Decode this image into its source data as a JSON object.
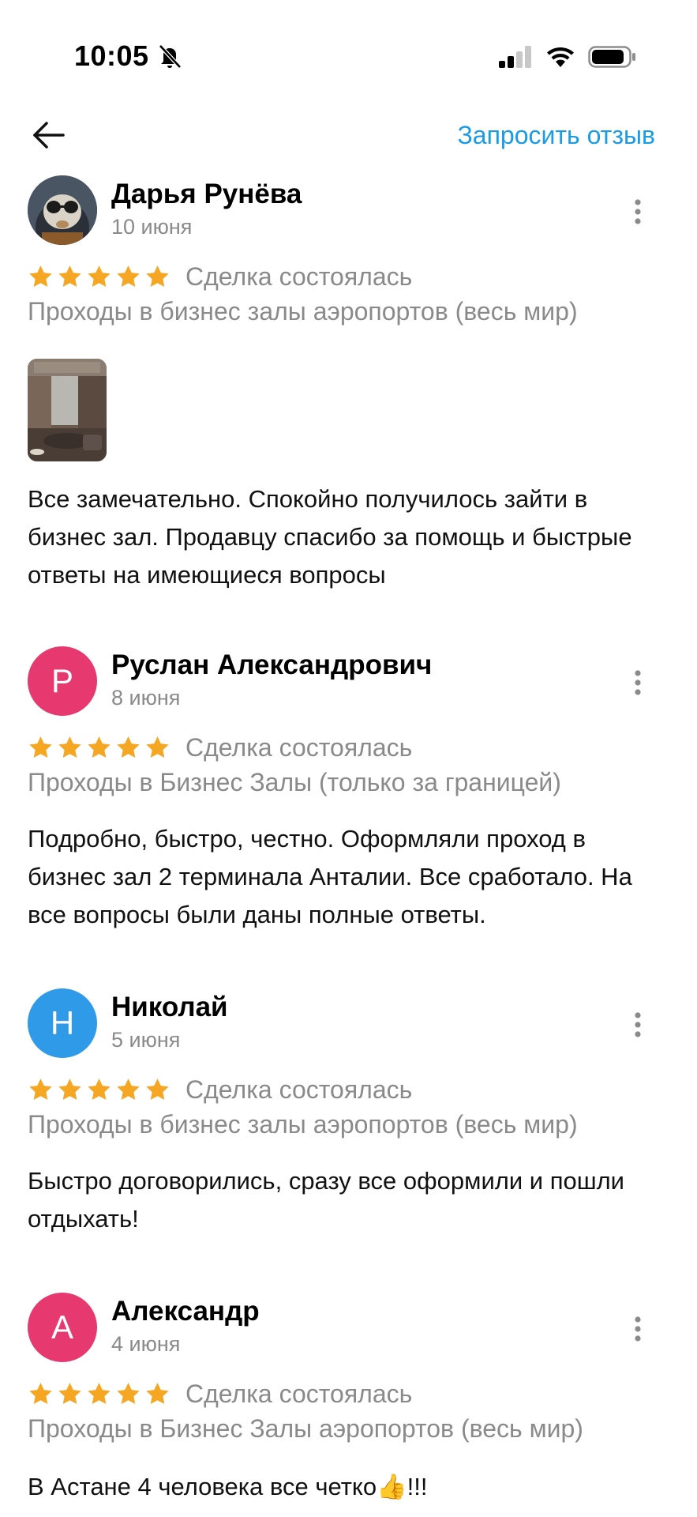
{
  "status_bar": {
    "time": "10:05"
  },
  "header": {
    "request_review_label": "Запросить отзыв"
  },
  "colors": {
    "accent": "#1a9be6",
    "star": "#f5a623",
    "secondary_text": "#8a8a8a"
  },
  "reviews": [
    {
      "author": "Дарья Рунёва",
      "date": "10 июня",
      "rating": 5,
      "deal_status": "Сделка состоялась",
      "category": "Проходы в бизнес залы аэропортов (весь мир)",
      "text": "Все замечательно. Спокойно получилось зайти в бизнес зал. Продавцу спасибо за помощь и быстрые ответы на имеющиеся вопросы",
      "has_photo": true
    },
    {
      "author": "Руслан Александрович",
      "avatar_letter": "Р",
      "avatar_color": "#e5396f",
      "date": "8 июня",
      "rating": 5,
      "deal_status": "Сделка состоялась",
      "category": "Проходы в Бизнес Залы (только за границей)",
      "text": "Подробно, быстро, честно. Оформляли проход в бизнес зал 2 терминала Анталии. Все сработало. На все вопросы были даны полные ответы."
    },
    {
      "author": "Николай",
      "avatar_letter": "Н",
      "avatar_color": "#2f9be8",
      "date": "5 июня",
      "rating": 5,
      "deal_status": "Сделка состоялась",
      "category": "Проходы в бизнес залы аэропортов (весь мир)",
      "text": "Быстро договорились, сразу все оформили и пошли отдыхать!"
    },
    {
      "author": "Александр",
      "avatar_letter": "А",
      "avatar_color": "#e5396f",
      "date": "4 июня",
      "rating": 5,
      "deal_status": "Сделка состоялась",
      "category": "Проходы в Бизнес Залы аэропортов (весь мир)",
      "text": "В Астане 4 человека все четко👍!!!"
    }
  ]
}
